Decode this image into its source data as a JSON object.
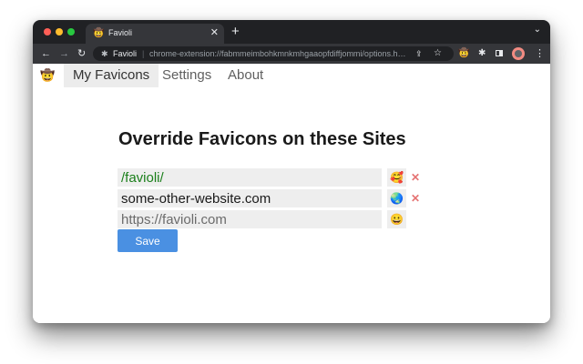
{
  "browser": {
    "tab": {
      "title": "Favioli",
      "favicon": "🤠",
      "close_glyph": "✕"
    },
    "new_tab_glyph": "+",
    "tabstrip_chevron_glyph": "⌄",
    "nav": {
      "back_glyph": "←",
      "forward_glyph": "→",
      "reload_glyph": "↻"
    },
    "omnibox": {
      "site_label": "Favioli",
      "separator": "|",
      "url": "chrome-extension://fabmmeimbohkmnkmhgaaopfdiffjommi/options.html",
      "share_glyph": "⇪",
      "star_glyph": "☆",
      "puzzle_glyph": "✱"
    },
    "toolbar": {
      "extension_favicon": "🤠",
      "puzzle_glyph": "✱",
      "menu_glyph": "⋮"
    },
    "colors": {
      "traffic_red": "#ff5f57",
      "traffic_yellow": "#febc2e",
      "traffic_green": "#28c840"
    }
  },
  "page": {
    "logo": "🤠",
    "tabs": [
      {
        "label": "My Favicons",
        "active": true
      },
      {
        "label": "Settings",
        "active": false
      },
      {
        "label": "About",
        "active": false
      }
    ],
    "heading": "Override Favicons on these Sites",
    "rows": [
      {
        "value": "/favioli/",
        "placeholder": "",
        "emoji": "🥰",
        "remove": "✕"
      },
      {
        "value": "some-other-website.com",
        "placeholder": "",
        "emoji": "🌏",
        "remove": "✕"
      },
      {
        "value": "",
        "placeholder": "https://favioli.com",
        "emoji": "😀"
      }
    ],
    "save_label": "Save",
    "colors": {
      "regex_text": "#1a7f1a",
      "remove": "#e57373",
      "save_button": "#4a90e2"
    }
  }
}
